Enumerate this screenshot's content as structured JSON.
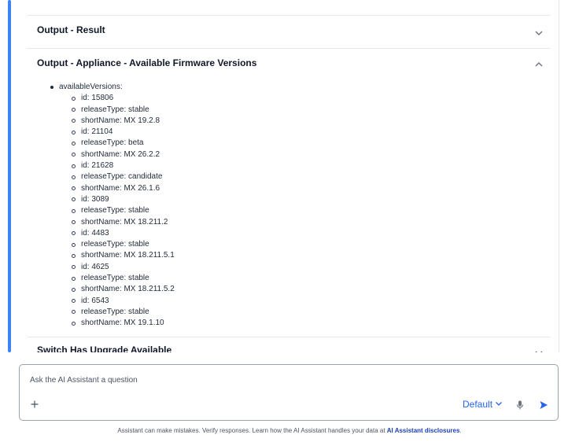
{
  "sections": [
    {
      "title": "Output - Result",
      "expanded": false
    },
    {
      "title": "Output - Appliance - Available Firmware Versions",
      "expanded": true
    },
    {
      "title": "Switch Has Upgrade Available",
      "expanded": false
    }
  ],
  "firmware": {
    "root_label": "availableVersions:",
    "items": [
      "id: 15806",
      "releaseType: stable",
      "shortName: MX 19.2.8",
      "id: 21104",
      "releaseType: beta",
      "shortName: MX 26.2.2",
      "id: 21628",
      "releaseType: candidate",
      "shortName: MX 26.1.6",
      "id: 3089",
      "releaseType: stable",
      "shortName: MX 18.211.2",
      "id: 4483",
      "releaseType: stable",
      "shortName: MX 18.211.5.1",
      "id: 4625",
      "releaseType: stable",
      "shortName: MX 18.211.5.2",
      "id: 6543",
      "releaseType: stable",
      "shortName: MX 19.1.10"
    ]
  },
  "composer": {
    "placeholder": "Ask the AI Assistant a question",
    "model_label": "Default",
    "icons": {
      "add": "plus-icon",
      "dropdown": "chevron-down-icon",
      "mic": "microphone-icon",
      "send": "send-icon"
    }
  },
  "footer": {
    "disclaimer_text": "Assistant can make mistakes. Verify responses. Learn how the AI Assistant handles your data at ",
    "disclaimer_link": "AI Assistant disclosures",
    "disclaimer_end": "."
  },
  "colors": {
    "accent": "#3b82f6",
    "link": "#2563eb"
  }
}
